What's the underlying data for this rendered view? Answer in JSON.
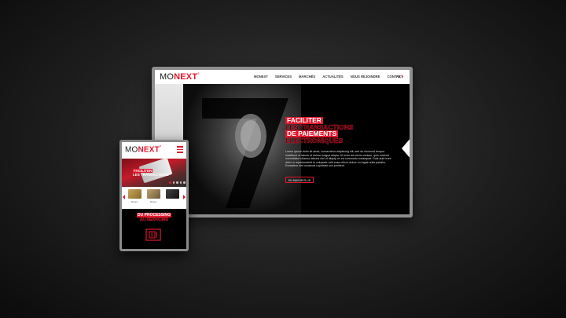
{
  "brand": {
    "logo_light": "MO",
    "logo_bold": "NEXT",
    "logo_mark": "°",
    "accent": "#e3182d"
  },
  "desktop": {
    "nav": {
      "items": [
        "MONEXT",
        "SERVICES",
        "MARCHÉS",
        "ACTUALITÉS",
        "NOUS REJOINDRE",
        "CONTACT"
      ],
      "lang": "FR",
      "lang_caret": "▾"
    },
    "hero": {
      "line1": "FACILITER",
      "line2": "LES TRANSACTIONS",
      "line3": "DE PAIEMENTS",
      "line4": "ÉLECTRONIQUES",
      "body": "Lorem ipsum dolor sit amet, consectetur adipiscing elit, sed do eiusmod tempor incididunt ut labore et dolore magna aliqua. Ut enim ad minim veniam, quis nostrud exercitation ullamco laboris nisi ut aliquip ex ea commodo consequat. Duis aute irure dolor in reprehenderit in voluptate velit esse cillum dolore eu fugiat nulla pariatur. Excepteur sint occaecat cupidatat non proident.",
      "button": "EN SAVOIR PLUS"
    }
  },
  "mobile": {
    "hero_line1": "FACILITER",
    "hero_line2": "LES TRANSACTIONS",
    "products": [
      "Monext",
      "Monext",
      ""
    ],
    "section_line1": "DU PROCESSING",
    "section_line2": "AU SERVICING"
  }
}
